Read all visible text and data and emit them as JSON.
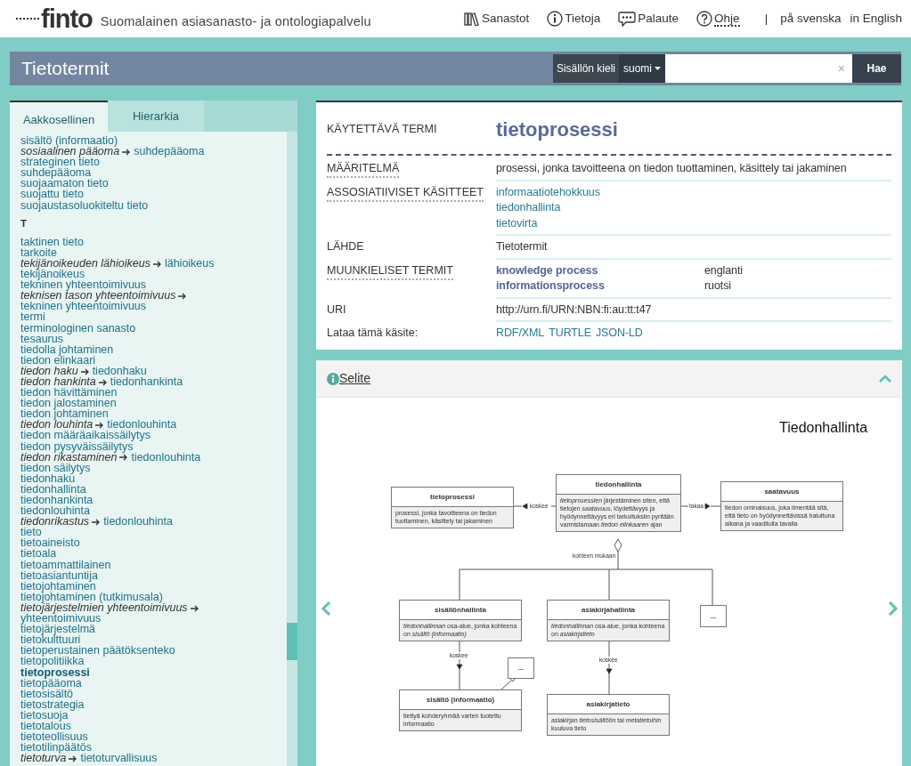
{
  "header": {
    "logo": "finto",
    "tagline": "Suomalainen asiasanasto- ja ontologiapalvelu",
    "nav": [
      {
        "label": "Sanastot",
        "tooltip": false
      },
      {
        "label": "Tietoja",
        "tooltip": false
      },
      {
        "label": "Palaute",
        "tooltip": false
      },
      {
        "label": "Ohje",
        "tooltip": true
      }
    ],
    "separator": "|",
    "languages": [
      "på svenska",
      "in English"
    ]
  },
  "vocab_bar": {
    "title": "Tietotermit",
    "content_language_label": "Sisällön kieli",
    "content_language": "suomi",
    "search_clear": "×",
    "search_button": "Hae"
  },
  "sidebar": {
    "tabs": [
      {
        "label": "Aakkosellinen",
        "selected": true
      },
      {
        "label": "Hierarkia",
        "selected": false
      }
    ],
    "items": [
      {
        "kind": "term",
        "label": "sisältö (informaatio)",
        "selected": false
      },
      {
        "kind": "ref",
        "label": "sosiaalinen pääoma",
        "target": "suhdepääoma"
      },
      {
        "kind": "term",
        "label": "strateginen tieto",
        "selected": false
      },
      {
        "kind": "term",
        "label": "suhdepääoma",
        "selected": false
      },
      {
        "kind": "term",
        "label": "suojaamaton tieto",
        "selected": false
      },
      {
        "kind": "term",
        "label": "suojattu tieto",
        "selected": false
      },
      {
        "kind": "term",
        "label": "suojaustasoluokiteltu tieto",
        "selected": false
      },
      {
        "kind": "letter",
        "label": "T"
      },
      {
        "kind": "term",
        "label": "taktinen tieto",
        "selected": false
      },
      {
        "kind": "term",
        "label": "tarkoite",
        "selected": false
      },
      {
        "kind": "ref",
        "label": "tekijänoikeuden lähioikeus",
        "target": "lähioikeus"
      },
      {
        "kind": "term",
        "label": "tekijänoikeus",
        "selected": false
      },
      {
        "kind": "term",
        "label": "tekninen yhteentoimivuus",
        "selected": false
      },
      {
        "kind": "ref",
        "label": "teknisen tason yhteentoimivuus",
        "target": "tekninen yhteentoimivuus"
      },
      {
        "kind": "term",
        "label": "termi",
        "selected": false
      },
      {
        "kind": "term",
        "label": "terminologinen sanasto",
        "selected": false
      },
      {
        "kind": "term",
        "label": "tesaurus",
        "selected": false
      },
      {
        "kind": "term",
        "label": "tiedolla johtaminen",
        "selected": false
      },
      {
        "kind": "term",
        "label": "tiedon elinkaari",
        "selected": false
      },
      {
        "kind": "ref",
        "label": "tiedon haku",
        "target": "tiedonhaku"
      },
      {
        "kind": "ref",
        "label": "tiedon hankinta",
        "target": "tiedonhankinta"
      },
      {
        "kind": "term",
        "label": "tiedon hävittäminen",
        "selected": false
      },
      {
        "kind": "term",
        "label": "tiedon jalostaminen",
        "selected": false
      },
      {
        "kind": "term",
        "label": "tiedon johtaminen",
        "selected": false
      },
      {
        "kind": "ref",
        "label": "tiedon louhinta",
        "target": "tiedonlouhinta"
      },
      {
        "kind": "term",
        "label": "tiedon määräaikaissäilytys",
        "selected": false
      },
      {
        "kind": "term",
        "label": "tiedon pysyväissäilytys",
        "selected": false
      },
      {
        "kind": "ref",
        "label": "tiedon rikastaminen",
        "target": "tiedonlouhinta"
      },
      {
        "kind": "term",
        "label": "tiedon säilytys",
        "selected": false
      },
      {
        "kind": "term",
        "label": "tiedonhaku",
        "selected": false
      },
      {
        "kind": "term",
        "label": "tiedonhallinta",
        "selected": false
      },
      {
        "kind": "term",
        "label": "tiedonhankinta",
        "selected": false
      },
      {
        "kind": "term",
        "label": "tiedonlouhinta",
        "selected": false
      },
      {
        "kind": "ref",
        "label": "tiedonrikastus",
        "target": "tiedonlouhinta"
      },
      {
        "kind": "term",
        "label": "tieto",
        "selected": false
      },
      {
        "kind": "term",
        "label": "tietoaineisto",
        "selected": false
      },
      {
        "kind": "term",
        "label": "tietoala",
        "selected": false
      },
      {
        "kind": "term",
        "label": "tietoammattilainen",
        "selected": false
      },
      {
        "kind": "term",
        "label": "tietoasiantuntija",
        "selected": false
      },
      {
        "kind": "term",
        "label": "tietojohtaminen",
        "selected": false
      },
      {
        "kind": "term",
        "label": "tietojohtaminen (tutkimusala)",
        "selected": false
      },
      {
        "kind": "ref",
        "label": "tietojärjestelmien yhteentoimivuus",
        "target": "yhteentoimivuus"
      },
      {
        "kind": "term",
        "label": "tietojärjestelmä",
        "selected": false
      },
      {
        "kind": "term",
        "label": "tietokulttuuri",
        "selected": false
      },
      {
        "kind": "term",
        "label": "tietoperustainen päätöksenteko",
        "selected": false
      },
      {
        "kind": "term",
        "label": "tietopolitiikka",
        "selected": false
      },
      {
        "kind": "term",
        "label": "tietoprosessi",
        "selected": true
      },
      {
        "kind": "term",
        "label": "tietopääoma",
        "selected": false
      },
      {
        "kind": "term",
        "label": "tietosisältö",
        "selected": false
      },
      {
        "kind": "term",
        "label": "tietostrategia",
        "selected": false
      },
      {
        "kind": "term",
        "label": "tietosuoja",
        "selected": false
      },
      {
        "kind": "term",
        "label": "tietotalous",
        "selected": false
      },
      {
        "kind": "term",
        "label": "tietoteollisuus",
        "selected": false
      },
      {
        "kind": "term",
        "label": "tietotilinpäätös",
        "selected": false
      },
      {
        "kind": "ref",
        "label": "tietoturva",
        "target": "tietoturvallisuus"
      }
    ]
  },
  "concept": {
    "preferred_label_heading": "KÄYTETTÄVÄ TERMI",
    "preferred_label": "tietoprosessi",
    "properties": [
      {
        "kind": "text",
        "label": "MÄÄRITELMÄ",
        "tooltip": true,
        "value": "prosessi, jonka tavoitteena on tiedon tuottaminen, käsittely tai jakaminen"
      },
      {
        "kind": "links",
        "label": "ASSOSIATIIVISET KÄSITTEET",
        "tooltip": true,
        "values": [
          "informaatiotehokkuus",
          "tiedonhallinta",
          "tietovirta"
        ]
      },
      {
        "kind": "text",
        "label": "LÄHDE",
        "tooltip": false,
        "value": "Tietotermit"
      },
      {
        "kind": "translations",
        "label": "MUUNKIELISET TERMIT",
        "tooltip": true,
        "values": [
          {
            "term": "knowledge process",
            "language": "englanti"
          },
          {
            "term": "informationsprocess",
            "language": "ruotsi"
          }
        ]
      },
      {
        "kind": "text",
        "label": "URI",
        "tooltip": false,
        "value": "http://urn.fi/URN:NBN:fi:au:tt:t47"
      },
      {
        "kind": "downloads",
        "label": "Lataa tämä käsite:",
        "tooltip": false,
        "values": [
          "RDF/XML",
          "TURTLE",
          "JSON-LD"
        ]
      }
    ]
  },
  "appendix": {
    "title": "Selite",
    "expanded": true,
    "diagram": {
      "title": "Tiedonhallinta",
      "nodes": [
        {
          "kind": "class",
          "name": "tietoprosessi",
          "description": "prosessi, jonka tavoitteena on tiedon tuottaminen, käsittely tai jakaminen"
        },
        {
          "kind": "class",
          "name": "tiedonhallinta",
          "description": "*tietoprosessien* järjestäminen siten, että tietojen *saatavuus*, löydettävyys ja hyödynnettävyys eri tarkoituksiin pyritään varmistamaan *tiedon elinkaaren* ajan"
        },
        {
          "kind": "class",
          "name": "saatavuus",
          "description": "tiedon ominaisuus, joka ilmentää sitä, että tieto on hyödynnettävissä haluttuna aikana ja vaaditulla tavalla"
        },
        {
          "kind": "class",
          "name": "sisällönhallinta",
          "description": "*tiedonhallinnan* osa-alue, jonka kohteena on *sisältö (informaatio)*"
        },
        {
          "kind": "class",
          "name": "asiakirjahallinta",
          "description": "*tiedonhallinnan* osa-alue, jonka kohteena on *asiakirjatieto*"
        },
        {
          "kind": "stub",
          "name": "..."
        },
        {
          "kind": "stub",
          "name": "..."
        },
        {
          "kind": "class",
          "name": "sisältö (informaatio)",
          "description": "tiettyä kohderyhmää varten tuotettu informaatio"
        },
        {
          "kind": "class",
          "name": "asiakirjatieto",
          "description": "asiakirjan *tietosisältöön* tai *metatietoihin* kuuluva tieto"
        }
      ],
      "connectors": [
        {
          "kind": "association",
          "label": "koskee"
        },
        {
          "kind": "association",
          "label": "takaa"
        },
        {
          "kind": "aggregation",
          "label": "kohteen mukaan"
        },
        {
          "kind": "association",
          "label": "koskee"
        },
        {
          "kind": "association",
          "label": "koskee"
        },
        {
          "kind": "generalization"
        }
      ]
    }
  }
}
